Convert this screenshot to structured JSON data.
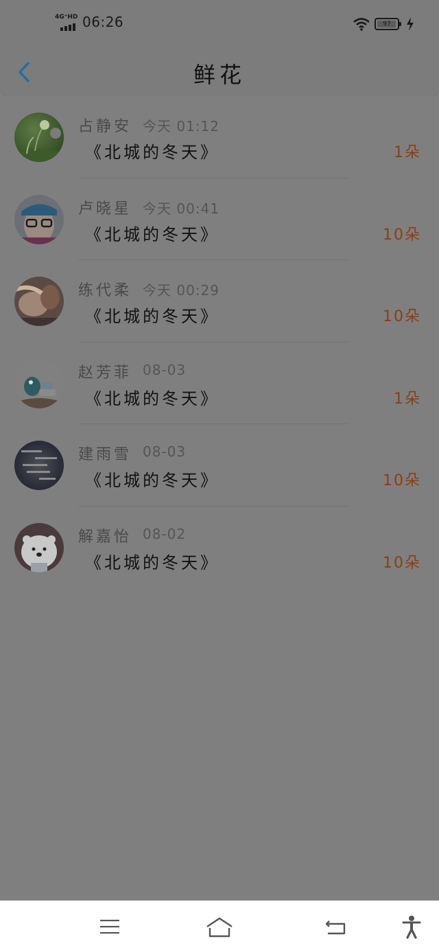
{
  "status_bar": {
    "network": "4G⁺HD",
    "time": "06:26",
    "battery": "97",
    "battery_level": 0.97
  },
  "header": {
    "title": "鲜花"
  },
  "records": [
    {
      "name": "占静安",
      "date": "今天 01:12",
      "song": "《北城的冬天》",
      "count": "1朵",
      "avatar": "avatar-dandelion"
    },
    {
      "name": "卢晓星",
      "date": "今天 00:41",
      "song": "《北城的冬天》",
      "count": "10朵",
      "avatar": "avatar-cap-glasses"
    },
    {
      "name": "练代柔",
      "date": "今天 00:29",
      "song": "《北城的冬天》",
      "count": "10朵",
      "avatar": "avatar-couple"
    },
    {
      "name": "赵芳菲",
      "date": "08-03",
      "song": "《北城的冬天》",
      "count": "1朵",
      "avatar": "avatar-cartoon"
    },
    {
      "name": "建雨雪",
      "date": "08-03",
      "song": "《北城的冬天》",
      "count": "10朵",
      "avatar": "avatar-text-dark"
    },
    {
      "name": "解嘉怡",
      "date": "08-02",
      "song": "《北城的冬天》",
      "count": "10朵",
      "avatar": "avatar-bear"
    }
  ],
  "colors": {
    "overlay": "#7f7f7f",
    "accent_blue": "#1f6fa8",
    "count_color": "#8a3f15",
    "nav_bg": "#ffffff"
  },
  "icons": {
    "back": "chevron-left-icon",
    "menu": "menu-icon",
    "home": "home-icon",
    "return": "return-icon",
    "accessibility": "accessibility-icon"
  }
}
